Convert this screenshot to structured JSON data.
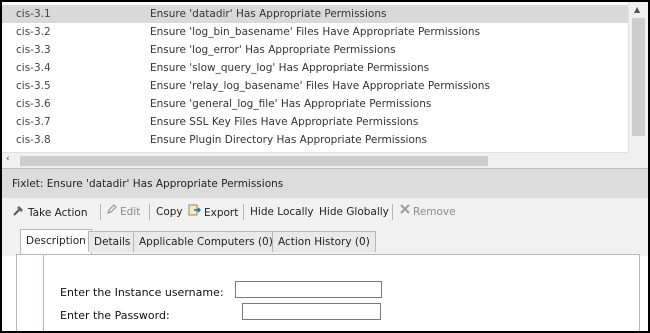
{
  "list": {
    "rows": [
      {
        "id": "cis-3.1",
        "name": "Ensure 'datadir' Has Appropriate Permissions",
        "selected": true
      },
      {
        "id": "cis-3.2",
        "name": "Ensure 'log_bin_basename' Files Have Appropriate Permissions"
      },
      {
        "id": "cis-3.3",
        "name": "Ensure 'log_error' Has Appropriate Permissions"
      },
      {
        "id": "cis-3.4",
        "name": "Ensure 'slow_query_log' Has Appropriate Permissions"
      },
      {
        "id": "cis-3.5",
        "name": "Ensure 'relay_log_basename' Files Have Appropriate Permissions"
      },
      {
        "id": "cis-3.6",
        "name": "Ensure 'general_log_file' Has Appropriate Permissions"
      },
      {
        "id": "cis-3.7",
        "name": "Ensure SSL Key Files Have Appropriate Permissions"
      },
      {
        "id": "cis-3.8",
        "name": "Ensure Plugin Directory Has Appropriate Permissions"
      }
    ]
  },
  "fixlet": {
    "title": "Fixlet: Ensure 'datadir' Has Appropriate Permissions"
  },
  "toolbar": {
    "take_action": "Take Action",
    "edit": "Edit",
    "copy": "Copy",
    "export": "Export",
    "hide_locally": "Hide Locally",
    "hide_globally": "Hide Globally",
    "remove": "Remove"
  },
  "tabs": [
    {
      "label": "Description",
      "active": true
    },
    {
      "label": "Details"
    },
    {
      "label": "Applicable Computers (0)"
    },
    {
      "label": "Action History (0)"
    }
  ],
  "form": {
    "username_label": "Enter the Instance username:",
    "username_value": "",
    "password_label": "Enter the Password:",
    "password_value": ""
  },
  "colors": {
    "selected_row": "#d9d9d9",
    "header_bg": "#dcdcdc",
    "remove_icon": "#c0392b"
  }
}
